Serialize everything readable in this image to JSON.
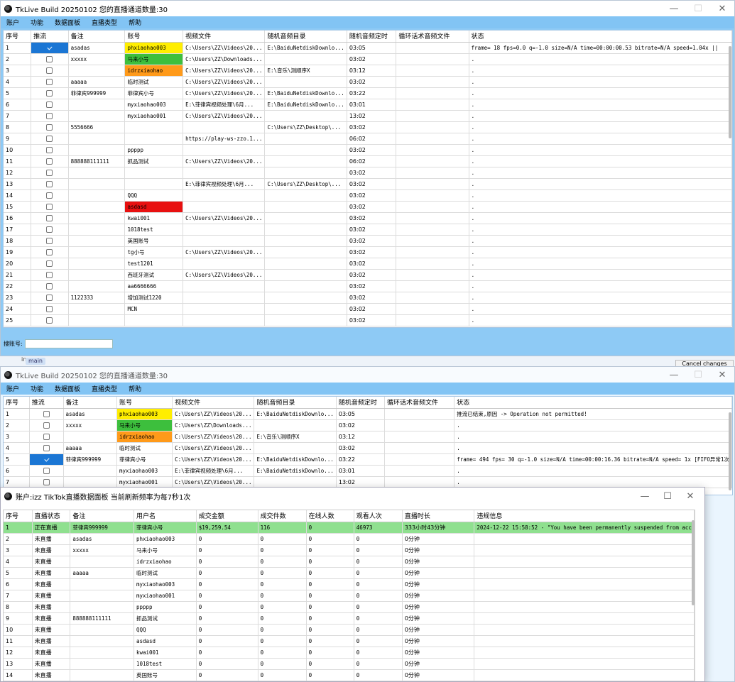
{
  "win1": {
    "title": "TkLive Build 20250102 您的直播通道数量:30",
    "menu": [
      "账户",
      "功能",
      "数据面板",
      "直播类型",
      "帮助"
    ],
    "columns": [
      "序号",
      "推流",
      "备注",
      "账号",
      "视频文件",
      "随机音频目录",
      "随机音频定时",
      "循环话术音频文件",
      "状态"
    ],
    "rows": [
      {
        "n": "1",
        "checked": true,
        "note": "asadas",
        "acct": "phxiaohao003",
        "acct_bg": "#ffee00",
        "video": "C:\\Users\\ZZ\\Videos\\20...",
        "audio": "E:\\BaiduNetdiskDownlo...",
        "timer": "03:05",
        "loop": "",
        "status": "frame= 18 fps=0.0 q=-1.0 size=N/A time=00:00:00.53 bitrate=N/A speed=1.04x ||"
      },
      {
        "n": "2",
        "checked": false,
        "note": "xxxxx",
        "acct": "马来小号",
        "acct_bg": "#3dbf3d",
        "video": "C:\\Users\\ZZ\\Downloads...",
        "audio": "",
        "timer": "03:02",
        "loop": "",
        "status": "."
      },
      {
        "n": "3",
        "checked": false,
        "note": "",
        "acct": "idrzxiaohao",
        "acct_bg": "#ff9a1a",
        "video": "C:\\Users\\ZZ\\Videos\\20...",
        "audio": "E:\\音乐\\测顺序X",
        "timer": "03:12",
        "loop": "",
        "status": "."
      },
      {
        "n": "4",
        "checked": false,
        "note": "aaaaa",
        "acct": "临时测试",
        "acct_bg": "",
        "video": "C:\\Users\\ZZ\\Videos\\20...",
        "audio": "",
        "timer": "03:02",
        "loop": "",
        "status": "."
      },
      {
        "n": "5",
        "checked": false,
        "note": "菲律宾999999",
        "acct": "菲律宾小号",
        "acct_bg": "",
        "video": "C:\\Users\\ZZ\\Videos\\20...",
        "audio": "E:\\BaiduNetdiskDownlo...",
        "timer": "03:22",
        "loop": "",
        "status": "."
      },
      {
        "n": "6",
        "checked": false,
        "note": "",
        "acct": "myxiaohao003",
        "acct_bg": "",
        "video": "E:\\菲律宾视频处理\\6月...",
        "audio": "E:\\BaiduNetdiskDownlo...",
        "timer": "03:01",
        "loop": "",
        "status": "."
      },
      {
        "n": "7",
        "checked": false,
        "note": "",
        "acct": "myxiaohao001",
        "acct_bg": "",
        "video": "C:\\Users\\ZZ\\Videos\\20...",
        "audio": "",
        "timer": "13:02",
        "loop": "",
        "status": "."
      },
      {
        "n": "8",
        "checked": false,
        "note": "5556666",
        "acct": "",
        "acct_bg": "",
        "video": "",
        "audio": "C:\\Users\\ZZ\\Desktop\\...",
        "timer": "03:02",
        "loop": "",
        "status": "."
      },
      {
        "n": "9",
        "checked": false,
        "note": "",
        "acct": "",
        "acct_bg": "",
        "video": "https://play-ws-zzo.1...",
        "audio": "",
        "timer": "06:02",
        "loop": "",
        "status": "."
      },
      {
        "n": "10",
        "checked": false,
        "note": "",
        "acct": "ppppp",
        "acct_bg": "",
        "video": "",
        "audio": "",
        "timer": "03:02",
        "loop": "",
        "status": "."
      },
      {
        "n": "11",
        "checked": false,
        "note": "888888111111",
        "acct": "抓品测试",
        "acct_bg": "",
        "video": "C:\\Users\\ZZ\\Videos\\20...",
        "audio": "",
        "timer": "06:02",
        "loop": "",
        "status": "."
      },
      {
        "n": "12",
        "checked": false,
        "note": "",
        "acct": "",
        "acct_bg": "",
        "video": "",
        "audio": "",
        "timer": "03:02",
        "loop": "",
        "status": "."
      },
      {
        "n": "13",
        "checked": false,
        "note": "",
        "acct": "",
        "acct_bg": "",
        "video": "E:\\菲律宾视频处理\\6月...",
        "audio": "C:\\Users\\ZZ\\Desktop\\...",
        "timer": "03:02",
        "loop": "",
        "status": "."
      },
      {
        "n": "14",
        "checked": false,
        "note": "",
        "acct": "QQQ",
        "acct_bg": "",
        "video": "",
        "audio": "",
        "timer": "03:02",
        "loop": "",
        "status": "."
      },
      {
        "n": "15",
        "checked": false,
        "note": "",
        "acct": "asdasd",
        "acct_bg": "#e81010",
        "video": "",
        "audio": "",
        "timer": "03:02",
        "loop": "",
        "status": "."
      },
      {
        "n": "16",
        "checked": false,
        "note": "",
        "acct": "kwai001",
        "acct_bg": "",
        "video": "C:\\Users\\ZZ\\Videos\\20...",
        "audio": "",
        "timer": "03:02",
        "loop": "",
        "status": "."
      },
      {
        "n": "17",
        "checked": false,
        "note": "",
        "acct": "1018test",
        "acct_bg": "",
        "video": "",
        "audio": "",
        "timer": "03:02",
        "loop": "",
        "status": "."
      },
      {
        "n": "18",
        "checked": false,
        "note": "",
        "acct": "英国账号",
        "acct_bg": "",
        "video": "",
        "audio": "",
        "timer": "03:02",
        "loop": "",
        "status": "."
      },
      {
        "n": "19",
        "checked": false,
        "note": "",
        "acct": "tg小号",
        "acct_bg": "",
        "video": "C:\\Users\\ZZ\\Videos\\20...",
        "audio": "",
        "timer": "03:02",
        "loop": "",
        "status": "."
      },
      {
        "n": "20",
        "checked": false,
        "note": "",
        "acct": "test1201",
        "acct_bg": "",
        "video": "",
        "audio": "",
        "timer": "03:02",
        "loop": "",
        "status": "."
      },
      {
        "n": "21",
        "checked": false,
        "note": "",
        "acct": "西班牙测试",
        "acct_bg": "",
        "video": "C:\\Users\\ZZ\\Videos\\20...",
        "audio": "",
        "timer": "03:02",
        "loop": "",
        "status": "."
      },
      {
        "n": "22",
        "checked": false,
        "note": "",
        "acct": "aa6666666",
        "acct_bg": "",
        "video": "",
        "audio": "",
        "timer": "03:02",
        "loop": "",
        "status": "."
      },
      {
        "n": "23",
        "checked": false,
        "note": "1122333",
        "acct": "增加测试1220",
        "acct_bg": "",
        "video": "",
        "audio": "",
        "timer": "03:02",
        "loop": "",
        "status": "."
      },
      {
        "n": "24",
        "checked": false,
        "note": "",
        "acct": "MCN",
        "acct_bg": "",
        "video": "",
        "audio": "",
        "timer": "03:02",
        "loop": "",
        "status": "."
      },
      {
        "n": "25",
        "checked": false,
        "note": "",
        "acct": "",
        "acct_bg": "",
        "video": "",
        "audio": "",
        "timer": "03:02",
        "loop": "",
        "status": "."
      }
    ],
    "search_label": "搜账号:",
    "search_value": ""
  },
  "background": {
    "fragment_text": "in",
    "main_tag": "main",
    "cancel_changes": "Cancel changes"
  },
  "win2": {
    "title": "TkLive Build 20250102 您的直播通道数量:30",
    "menu": [
      "账户",
      "功能",
      "数据面板",
      "直播类型",
      "帮助"
    ],
    "columns": [
      "序号",
      "推流",
      "备注",
      "账号",
      "视频文件",
      "随机音频目录",
      "随机音频定时",
      "循环话术音频文件",
      "状态"
    ],
    "rows": [
      {
        "n": "1",
        "checked": false,
        "note": "asadas",
        "acct": "phxiaohao003",
        "acct_bg": "#ffee00",
        "video": "C:\\Users\\ZZ\\Videos\\20...",
        "audio": "E:\\BaiduNetdiskDownlo...",
        "timer": "03:05",
        "loop": "",
        "status": "推流已结束,原因 -> Operation not permitted!"
      },
      {
        "n": "2",
        "checked": false,
        "note": "xxxxx",
        "acct": "马来小号",
        "acct_bg": "#3dbf3d",
        "video": "C:\\Users\\ZZ\\Downloads...",
        "audio": "",
        "timer": "03:02",
        "loop": "",
        "status": "."
      },
      {
        "n": "3",
        "checked": false,
        "note": "",
        "acct": "idrzxiaohao",
        "acct_bg": "#ff9a1a",
        "video": "C:\\Users\\ZZ\\Videos\\20...",
        "audio": "E:\\音乐\\测顺序X",
        "timer": "03:12",
        "loop": "",
        "status": "."
      },
      {
        "n": "4",
        "checked": false,
        "note": "aaaaa",
        "acct": "临时测试",
        "acct_bg": "",
        "video": "C:\\Users\\ZZ\\Videos\\20...",
        "audio": "",
        "timer": "03:02",
        "loop": "",
        "status": "."
      },
      {
        "n": "5",
        "checked": true,
        "note": "菲律宾999999",
        "acct": "菲律宾小号",
        "acct_bg": "",
        "video": "C:\\Users\\ZZ\\Videos\\20...",
        "audio": "E:\\BaiduNetdiskDownlo...",
        "timer": "03:22",
        "loop": "",
        "status": "frame= 494 fps= 30 q=-1.0 size=N/A time=00:00:16.36 bitrate=N/A speed= 1x [FIFO异常1次"
      },
      {
        "n": "6",
        "checked": false,
        "note": "",
        "acct": "myxiaohao003",
        "acct_bg": "",
        "video": "E:\\菲律宾视频处理\\6月...",
        "audio": "E:\\BaiduNetdiskDownlo...",
        "timer": "03:01",
        "loop": "",
        "status": "."
      },
      {
        "n": "7",
        "checked": false,
        "note": "",
        "acct": "myxiaohao001",
        "acct_bg": "",
        "video": "C:\\Users\\ZZ\\Videos\\20...",
        "audio": "",
        "timer": "13:02",
        "loop": "",
        "status": "."
      }
    ]
  },
  "win3": {
    "title": "账户:izz  TikTok直播数据面板  当前刷新频率为每7秒1次",
    "columns": [
      "序号",
      "直播状态",
      "备注",
      "用户名",
      "成交金额",
      "成交件数",
      "在线人数",
      "观看人次",
      "直播时长",
      "违规信息"
    ],
    "rows": [
      {
        "n": "1",
        "state": "正在直播",
        "note": "菲律宾999999",
        "user": "菲律宾小号",
        "amount": "$19,259.54",
        "items": "116",
        "online": "0",
        "views": "46973",
        "duration": "333小时43分钟",
        "violation": "2024-12-22 15:58:52 - \"You have been permanently suspended from acc",
        "live": true
      },
      {
        "n": "2",
        "state": "未直播",
        "note": "asadas",
        "user": "phxiaohao003",
        "amount": "0",
        "items": "0",
        "online": "0",
        "views": "0",
        "duration": "0分钟",
        "violation": "",
        "live": false
      },
      {
        "n": "3",
        "state": "未直播",
        "note": "xxxxx",
        "user": "马来小号",
        "amount": "0",
        "items": "0",
        "online": "0",
        "views": "0",
        "duration": "0分钟",
        "violation": "",
        "live": false
      },
      {
        "n": "4",
        "state": "未直播",
        "note": "",
        "user": "idrzxiaohao",
        "amount": "0",
        "items": "0",
        "online": "0",
        "views": "0",
        "duration": "0分钟",
        "violation": "",
        "live": false
      },
      {
        "n": "5",
        "state": "未直播",
        "note": "aaaaa",
        "user": "临时测试",
        "amount": "0",
        "items": "0",
        "online": "0",
        "views": "0",
        "duration": "0分钟",
        "violation": "",
        "live": false
      },
      {
        "n": "6",
        "state": "未直播",
        "note": "",
        "user": "myxiaohao003",
        "amount": "0",
        "items": "0",
        "online": "0",
        "views": "0",
        "duration": "0分钟",
        "violation": "",
        "live": false
      },
      {
        "n": "7",
        "state": "未直播",
        "note": "",
        "user": "myxiaohao001",
        "amount": "0",
        "items": "0",
        "online": "0",
        "views": "0",
        "duration": "0分钟",
        "violation": "",
        "live": false
      },
      {
        "n": "8",
        "state": "未直播",
        "note": "",
        "user": "ppppp",
        "amount": "0",
        "items": "0",
        "online": "0",
        "views": "0",
        "duration": "0分钟",
        "violation": "",
        "live": false
      },
      {
        "n": "9",
        "state": "未直播",
        "note": "888888111111",
        "user": "抓品测试",
        "amount": "0",
        "items": "0",
        "online": "0",
        "views": "0",
        "duration": "0分钟",
        "violation": "",
        "live": false
      },
      {
        "n": "10",
        "state": "未直播",
        "note": "",
        "user": "QQQ",
        "amount": "0",
        "items": "0",
        "online": "0",
        "views": "0",
        "duration": "0分钟",
        "violation": "",
        "live": false
      },
      {
        "n": "11",
        "state": "未直播",
        "note": "",
        "user": "asdasd",
        "amount": "0",
        "items": "0",
        "online": "0",
        "views": "0",
        "duration": "0分钟",
        "violation": "",
        "live": false
      },
      {
        "n": "12",
        "state": "未直播",
        "note": "",
        "user": "kwai001",
        "amount": "0",
        "items": "0",
        "online": "0",
        "views": "0",
        "duration": "0分钟",
        "violation": "",
        "live": false
      },
      {
        "n": "13",
        "state": "未直播",
        "note": "",
        "user": "1018test",
        "amount": "0",
        "items": "0",
        "online": "0",
        "views": "0",
        "duration": "0分钟",
        "violation": "",
        "live": false
      },
      {
        "n": "14",
        "state": "未直播",
        "note": "",
        "user": "英国账号",
        "amount": "0",
        "items": "0",
        "online": "0",
        "views": "0",
        "duration": "0分钟",
        "violation": "",
        "live": false
      }
    ]
  },
  "icons": {
    "minimize": "—",
    "maximize": "☐",
    "close": "✕"
  }
}
